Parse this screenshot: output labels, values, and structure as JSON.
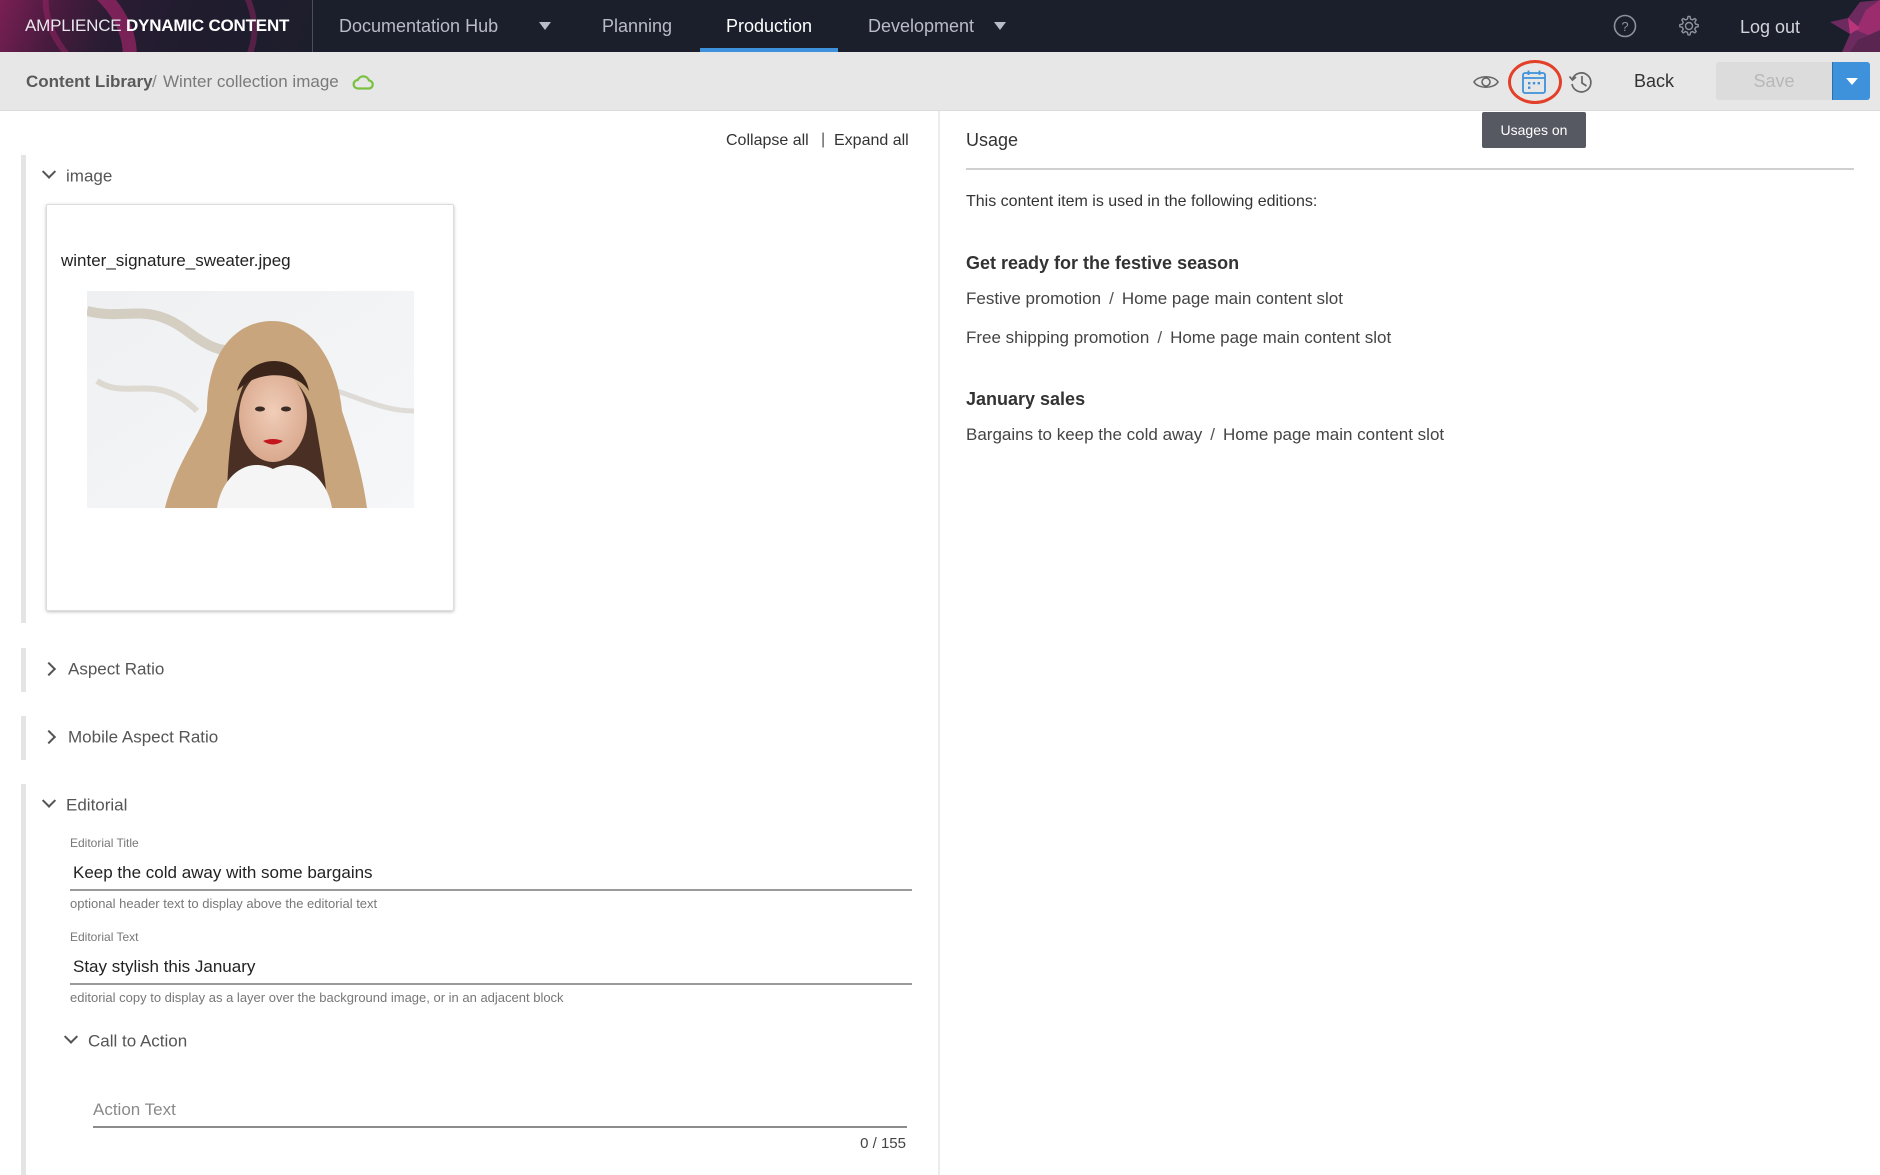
{
  "app": {
    "brand_light": "AMPLIENCE",
    "brand_bold": "DYNAMIC CONTENT"
  },
  "nav": {
    "items": [
      {
        "label": "Documentation Hub",
        "has_dropdown": true,
        "active": false
      },
      {
        "label": "Planning",
        "has_dropdown": false,
        "active": false
      },
      {
        "label": "Production",
        "has_dropdown": false,
        "active": true
      },
      {
        "label": "Development",
        "has_dropdown": true,
        "active": false
      }
    ],
    "help_icon": "help-circle-icon",
    "settings_icon": "gear-icon",
    "logout_label": "Log out"
  },
  "toolbar": {
    "breadcrumb_root": "Content Library",
    "breadcrumb_separator": "/",
    "breadcrumb_current": "Winter collection image",
    "sync_status_icon": "cloud-icon",
    "sync_status_color": "#7ac142",
    "preview_icon": "eye-icon",
    "usages_icon": "calendar-icon",
    "history_icon": "history-icon",
    "back_label": "Back",
    "save_label": "Save",
    "save_enabled": false,
    "accent_color": "#3d92db",
    "tooltip": "Usages on"
  },
  "editor": {
    "collapse_all": "Collapse all",
    "link_separator": "|",
    "expand_all": "Expand all",
    "sections": {
      "image": {
        "label": "image",
        "expanded": true,
        "file_name": "winter_signature_sweater.jpeg"
      },
      "aspect_ratio": {
        "label": "Aspect Ratio",
        "expanded": false
      },
      "mobile_aspect_ratio": {
        "label": "Mobile Aspect Ratio",
        "expanded": false
      },
      "editorial": {
        "label": "Editorial",
        "expanded": true,
        "title_label": "Editorial Title",
        "title_value": "Keep the cold away with some bargains",
        "title_help": "optional header text to display above the editorial text",
        "text_label": "Editorial Text",
        "text_value": "Stay stylish this January",
        "text_help": "editorial copy to display as a layer over the background image, or in an adjacent block",
        "cta": {
          "label": "Call to Action",
          "expanded": true,
          "action_placeholder": "Action Text",
          "action_value": "",
          "counter": "0 / 155"
        }
      }
    }
  },
  "usage": {
    "title": "Usage",
    "intro": "This content item is used in the following editions:",
    "groups": [
      {
        "title": "Get ready for the festive season",
        "rows": [
          {
            "edition": "Festive promotion",
            "slot": "Home page main content slot"
          },
          {
            "edition": "Free shipping promotion",
            "slot": "Home page main content slot"
          }
        ]
      },
      {
        "title": "January sales",
        "rows": [
          {
            "edition": "Bargains to keep the cold away",
            "slot": "Home page main content slot"
          }
        ]
      }
    ]
  }
}
